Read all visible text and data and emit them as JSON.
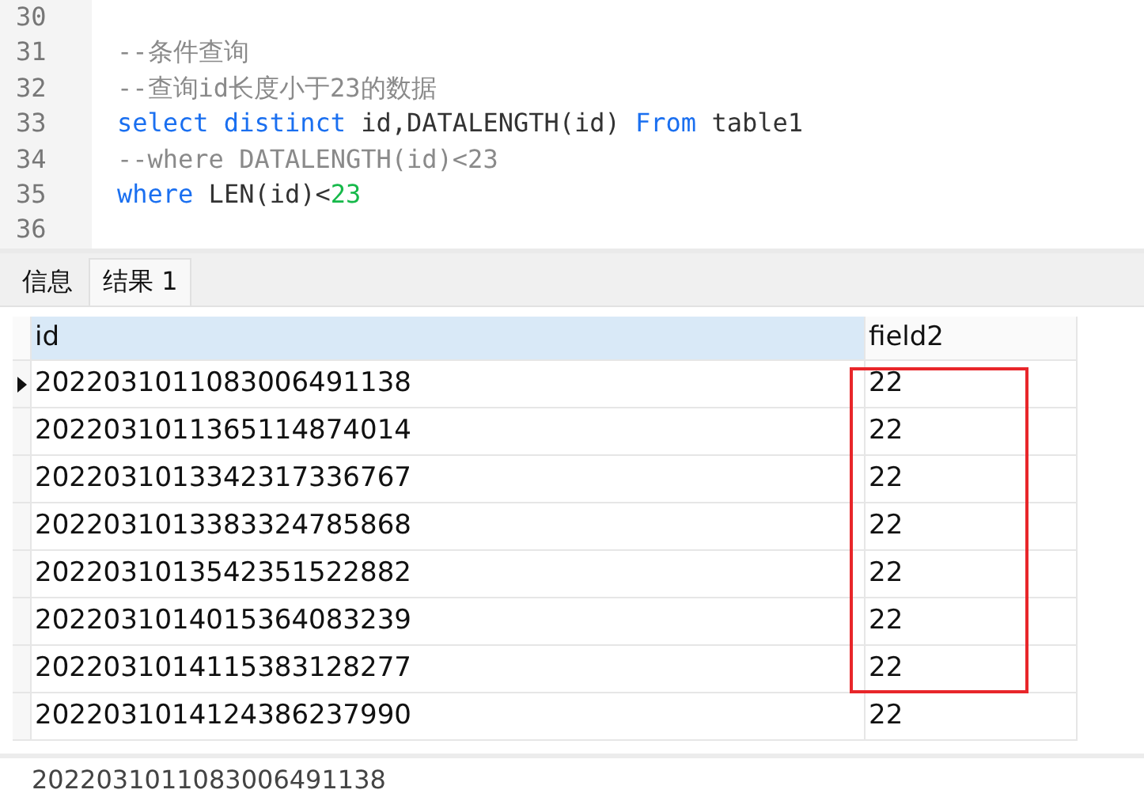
{
  "editor": {
    "lines": [
      {
        "number": "30"
      },
      {
        "number": "31",
        "tokens": [
          {
            "kind": "comment",
            "text": "--条件查询"
          }
        ]
      },
      {
        "number": "32",
        "tokens": [
          {
            "kind": "comment",
            "text": "--查询id长度小于23的数据"
          }
        ]
      },
      {
        "number": "33",
        "tokens": [
          {
            "kind": "keyword",
            "text": "select distinct"
          },
          {
            "kind": "plain",
            "text": " id,DATALENGTH(id) "
          },
          {
            "kind": "keyword",
            "text": "From"
          },
          {
            "kind": "plain",
            "text": " table1"
          }
        ]
      },
      {
        "number": "34",
        "tokens": [
          {
            "kind": "comment",
            "text": "--where DATALENGTH(id)<23"
          }
        ]
      },
      {
        "number": "35",
        "tokens": [
          {
            "kind": "keyword",
            "text": "where"
          },
          {
            "kind": "plain",
            "text": " LEN(id)<"
          },
          {
            "kind": "number",
            "text": "23"
          }
        ]
      },
      {
        "number": "36"
      }
    ]
  },
  "result_tabs": [
    {
      "label": "信息",
      "selected": false
    },
    {
      "label": "结果 1",
      "selected": true
    }
  ],
  "table": {
    "columns": [
      {
        "label": "id",
        "selected": true
      },
      {
        "label": "field2",
        "selected": false
      }
    ],
    "rows": [
      {
        "cells": [
          "2022031011083006491138",
          "22"
        ],
        "current": true
      },
      {
        "cells": [
          "2022031011365114874014",
          "22"
        ],
        "current": false
      },
      {
        "cells": [
          "2022031013342317336767",
          "22"
        ],
        "current": false
      },
      {
        "cells": [
          "2022031013383324785868",
          "22"
        ],
        "current": false
      },
      {
        "cells": [
          "2022031013542351522882",
          "22"
        ],
        "current": false
      },
      {
        "cells": [
          "2022031014015364083239",
          "22"
        ],
        "current": false
      },
      {
        "cells": [
          "2022031014115383128277",
          "22"
        ],
        "current": false
      },
      {
        "cells": [
          "2022031014124386237990",
          "22"
        ],
        "current": false
      }
    ]
  },
  "status_text": "2022031011083006491138"
}
